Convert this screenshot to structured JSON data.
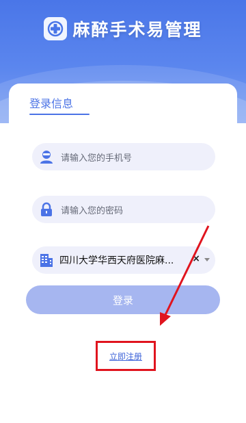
{
  "header": {
    "app_title": "麻醉手术易管理"
  },
  "login": {
    "tab_label": "登录信息",
    "phone_placeholder": "请输入您的手机号",
    "password_placeholder": "请输入您的密码",
    "hospital_value": "四川大学华西天府医院麻...",
    "clear_symbol": "×",
    "login_button": "登录",
    "register_link": "立即注册"
  },
  "colors": {
    "primary": "#4b73e6",
    "field_bg": "#eff0fb",
    "button_disabled": "#a6b6f0",
    "annotation_red": "#e0141e"
  },
  "icons": {
    "logo": "medical-cross-logo",
    "phone": "user-avatar-icon",
    "password": "lock-icon",
    "hospital": "building-icon",
    "clear": "close-icon",
    "dropdown": "caret-down-icon"
  }
}
